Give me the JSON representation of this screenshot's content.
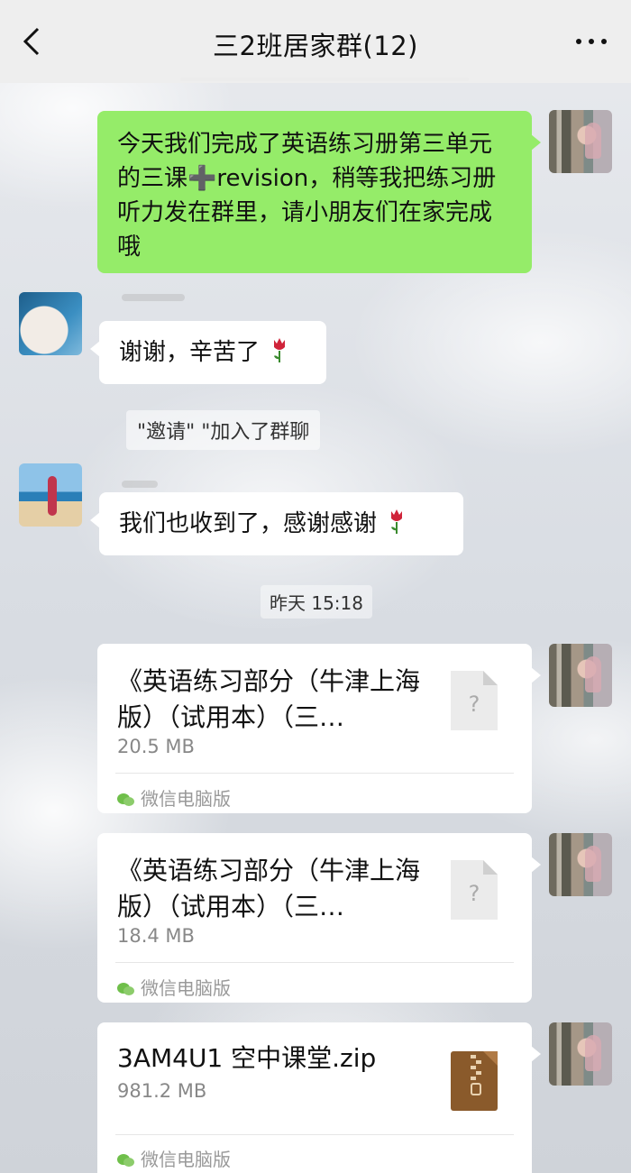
{
  "header": {
    "title": "三2班居家群(12)",
    "back_icon": "chevron-left-icon",
    "more_icon": "more-dots-icon"
  },
  "messages": {
    "teacher_msg": "今天我们完成了英语练习册第三单元的三课➕revision，稍等我把练习册听力发在群里，请小朋友们在家完成哦",
    "reply1": "谢谢，辛苦了",
    "system_notice": "\"邀请\"          \"加入了群聊",
    "reply2": "我们也收到了，感谢感谢",
    "timestamp": "昨天 15:18"
  },
  "files": [
    {
      "name": "《英语练习部分（牛津上海版）（试用本）（三…",
      "size": "20.5 MB",
      "source": "微信电脑版",
      "type": "unknown"
    },
    {
      "name": "《英语练习部分（牛津上海版）（试用本）（三…",
      "size": "18.4 MB",
      "source": "微信电脑版",
      "type": "unknown"
    },
    {
      "name": "3AM4U1 空中课堂.zip",
      "size": "981.2 MB",
      "source": "微信电脑版",
      "type": "zip"
    }
  ],
  "colors": {
    "self_bubble": "#95ec69",
    "other_bubble": "#ffffff",
    "header_bg": "#ededed"
  }
}
